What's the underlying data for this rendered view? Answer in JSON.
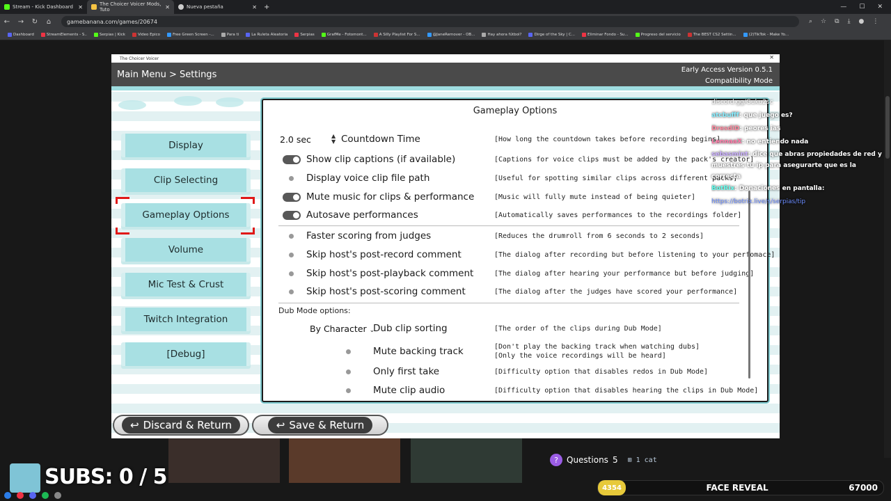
{
  "browser": {
    "tabs": [
      {
        "title": "Stream - Kick Dashboard"
      },
      {
        "title": "The Choicer Voicer Mods, Tuto"
      },
      {
        "title": "Nueva pestaña"
      }
    ],
    "url": "gamebanana.com/games/20674",
    "bookmarks": [
      "Dashboard",
      "StreamElements - S..",
      "Serpias | Kick",
      "Video Epico",
      "Free Green Screen -...",
      "Para ti",
      "La Ruleta Aleatoria",
      "Serpias",
      "GrafMe - Fotomont...",
      "A Silly Playlist For S...",
      "@JaneRemover - OB...",
      "Hay ahora fútbol?",
      "Dirge of the Sky | C...",
      "Eliminar Fondo - Su...",
      "Progreso del servicio",
      "The BEST CS2 Settin...",
      "(2)TikTok - Make Yo..."
    ]
  },
  "game": {
    "window_title": "The Choicer Voicer",
    "breadcrumb": "Main Menu > Settings",
    "version": "Early Access Version 0.5.1",
    "mode": "Compatibility Mode",
    "nav": [
      {
        "label": "Display"
      },
      {
        "label": "Clip Selecting"
      },
      {
        "label": "Gameplay Options",
        "selected": true
      },
      {
        "label": "Volume"
      },
      {
        "label": "Mic Test & Crust"
      },
      {
        "label": "Twitch Integration"
      },
      {
        "label": "[Debug]"
      }
    ],
    "panel": {
      "title": "Gameplay Options",
      "countdown_value": "2.0 sec",
      "rows": [
        {
          "label": "Countdown Time",
          "desc": "[How long the countdown takes before recording begins]"
        },
        {
          "label": "Show clip captions (if available)",
          "desc": "[Captions for voice clips must be added by the pack's creator]",
          "on": true
        },
        {
          "label": "Display voice clip file path",
          "desc": "[Useful for spotting similar clips across different packs]",
          "on": false
        },
        {
          "label": "Mute music for clips & performance",
          "desc": "[Music will fully mute instead of being quieter]",
          "on": true
        },
        {
          "label": "Autosave performances",
          "desc": "[Automatically saves performances to the recordings folder]",
          "on": true
        },
        {
          "label": "Faster scoring from judges",
          "desc": "[Reduces the drumroll from 6 seconds to 2 seconds]",
          "on": false
        },
        {
          "label": "Skip host's post-record comment",
          "desc": "[The dialog after recording but before listening to your perfomace]",
          "on": false
        },
        {
          "label": "Skip host's post-playback comment",
          "desc": "[The dialog after hearing your performance but before judging]",
          "on": false
        },
        {
          "label": "Skip host's post-scoring comment",
          "desc": "[The dialog after the judges have scored your performance]",
          "on": false
        }
      ],
      "dub_header": "Dub Mode options:",
      "dub_sort_value": "By Character",
      "dub_rows": [
        {
          "label": "Dub clip sorting",
          "desc": "[The order of the clips during Dub Mode]"
        },
        {
          "label": "Mute backing track",
          "desc": "[Don't play the backing track when watching dubs]",
          "desc2": "[Only the voice recordings will be heard]",
          "on": false
        },
        {
          "label": "Only first take",
          "desc": "[Difficulty option that disables redos in Dub Mode]",
          "on": false
        },
        {
          "label": "Mute clip audio",
          "desc": "[Difficulty option that disables hearing the clips in Dub Mode]",
          "on": false
        }
      ]
    },
    "discard_label": "Discard & Return",
    "save_label": "Save & Return"
  },
  "chat": {
    "top": "discord.gg/Guku2sc",
    "messages": [
      {
        "user": "atcbufff",
        "text": ": que juego es?"
      },
      {
        "user": "DresdiD",
        "text": ": peores ias"
      },
      {
        "user": "LennaaX",
        "text": ": no entiendo nada"
      },
      {
        "user": "sebasmint",
        "text": ": dice que abras propiedades de red y muestres tu ip para asegurarte que es la correcta"
      },
      {
        "user": "BotRix",
        "text": ": Donaciones en pantalla:"
      }
    ],
    "link": "https://botrix.live/s/serpias/tip"
  },
  "overlay": {
    "subs": "SUBS: 0 / 5",
    "questions_label": "Questions",
    "questions_count": "5",
    "cat": "1 cat",
    "coin": "4354",
    "face_reveal": "FACE REVEAL",
    "goal": "67000"
  },
  "colors": {
    "accent": "#a8e0e3",
    "selection": "#e01818",
    "topbar": "#4a4a4a"
  }
}
